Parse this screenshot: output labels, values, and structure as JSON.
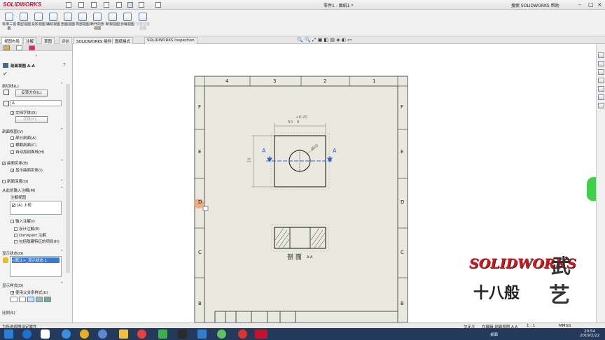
{
  "app": {
    "logo": "SOLIDWORKS",
    "document_title": "零件1 - 图纸1 *",
    "search_help": "搜索 SOLIDWORKS 帮助"
  },
  "ribbon": {
    "buttons": [
      "标准三视图",
      "模型视图",
      "投影视图",
      "辅助视图",
      "剖面视图",
      "局部视图",
      "断开的剖视图",
      "断裂视图",
      "剪裁视图",
      "交替位置视图"
    ]
  },
  "tabs": [
    "视图布局",
    "注解",
    "草图",
    "评估",
    "SOLIDWORKS 插件",
    "图纸格式",
    "SOLIDWORKS Inspection"
  ],
  "panel": {
    "title": "剖面视图 A-A",
    "cutting_line_label": "剖切线(L)",
    "reverse_button": "反转方向(L)",
    "label_value": "A",
    "doc_font": "文档字体(D)",
    "font_button": "字体(F)...",
    "section_view_label": "剖面视图(V)",
    "options": [
      "部分剖面(A)",
      "横截剖面(C)",
      "自动加剖面线(H)"
    ],
    "slice_label": "曲面实体(B)",
    "show_surface": "显示曲面实体(I)",
    "section_depth": "剖面深度(D)",
    "import_annotations": "从此处输入注解(M)",
    "annotation_view": "注解视图",
    "annotation_item": "(A) 上视",
    "import_items": "输入注解(I)",
    "design_annotations": "设计注解(E)",
    "dimxpert": "DimXpert 注解",
    "hidden_features": "包括隐藏特征的项目(H)",
    "display_state": "显示状态(D)",
    "display_state_item": "<默认>_显示状态 1",
    "display_style": "显示样式(D)",
    "use_parent": "使用父关系样式(U)",
    "scale": "比例(S)"
  },
  "drawing": {
    "cols": [
      "4",
      "3",
      "2",
      "1"
    ],
    "rows_left": [
      "F",
      "E",
      "D",
      "C",
      "B"
    ],
    "rows_right": [
      "F",
      "E",
      "D",
      "C",
      "B"
    ],
    "dim_top": "50",
    "dim_tol": "+0.20",
    "dim_tol2": "0",
    "dim_side": "50",
    "dim_dia": "Ø20",
    "section_label": "A",
    "caption": "剖 面",
    "caption_sub": "A-A"
  },
  "status": {
    "left": "为所选视图设定属性",
    "mid": "欠定义",
    "edit": "在编辑 剖面视图 A-A",
    "scale": "1 : 1",
    "units": "MMGS"
  },
  "clock": {
    "time": "20:54",
    "date": "2019/2/22",
    "tray": "桌面"
  },
  "watermark": {
    "line1": "SOLIDWORKS",
    "char1": "武",
    "line2": "十八般",
    "char2": "艺"
  }
}
